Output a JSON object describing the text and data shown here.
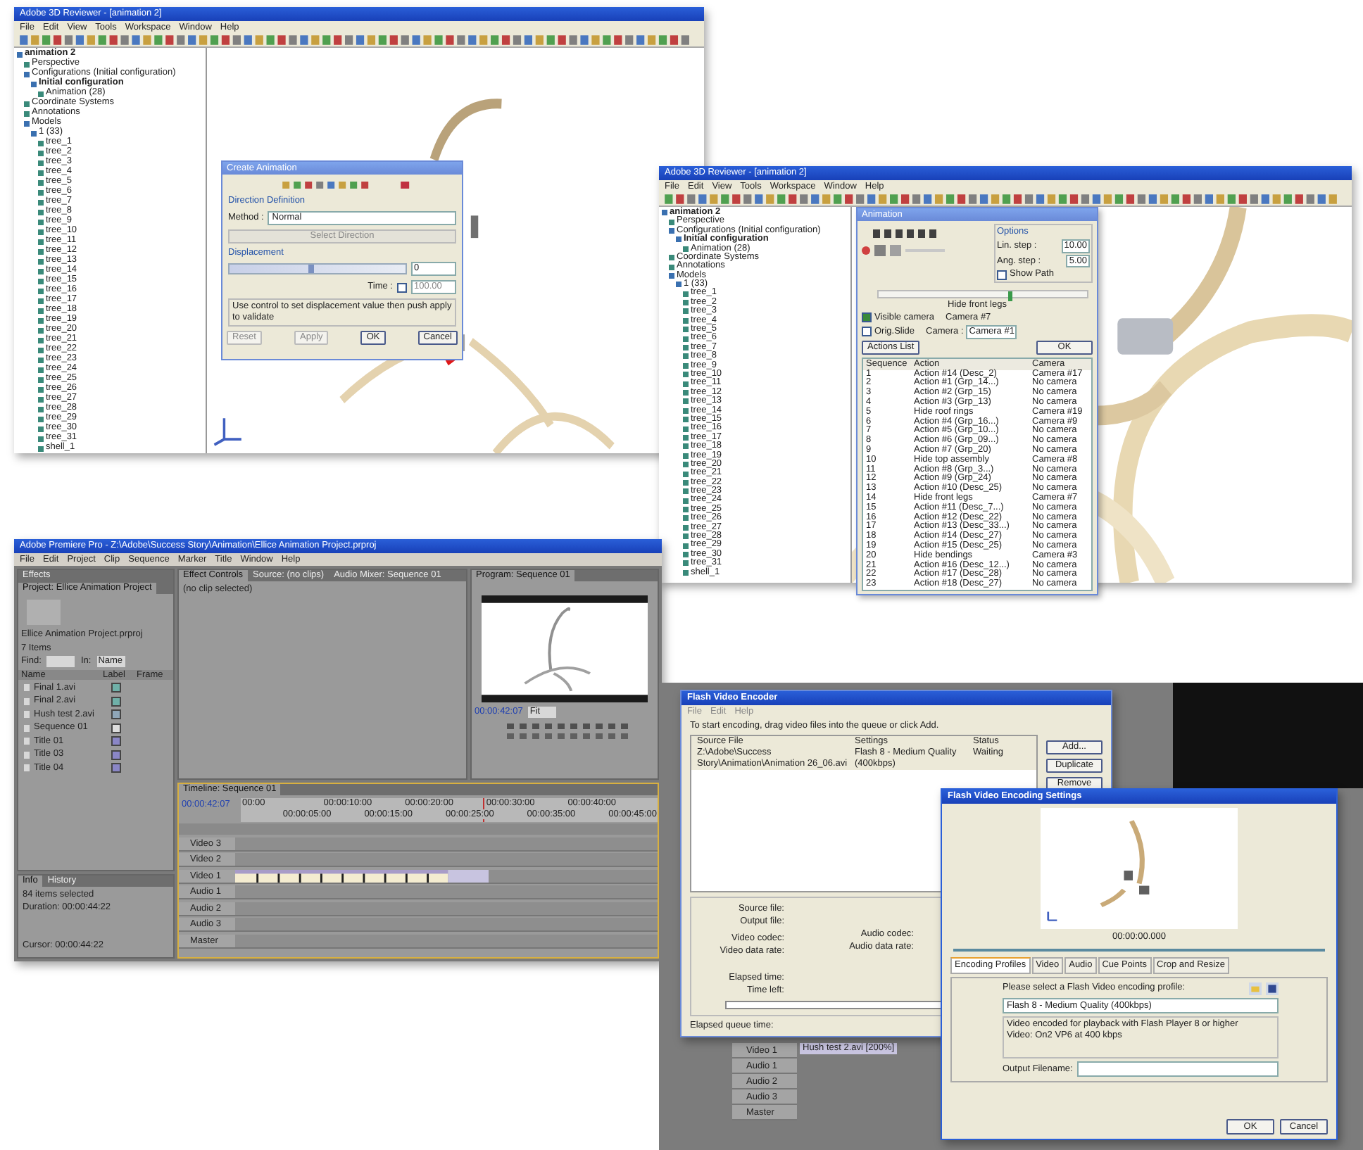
{
  "reviewer_1": {
    "title": "Adobe 3D Reviewer - [animation 2]",
    "menu": [
      "File",
      "Edit",
      "View",
      "Tools",
      "Workspace",
      "Window",
      "Help"
    ],
    "tree": [
      {
        "label": "animation 2",
        "children": [
          {
            "label": "Perspective"
          },
          {
            "label": "Configurations (Initial configuration)",
            "children": [
              {
                "label": "Initial configuration",
                "children": [
                  {
                    "label": "Animation (28)"
                  }
                ]
              }
            ]
          },
          {
            "label": "Coordinate Systems"
          },
          {
            "label": "Annotations"
          },
          {
            "label": "Models",
            "children": [
              {
                "label": "1 (33)",
                "children": [
                  {
                    "label": "tree_1"
                  },
                  {
                    "label": "tree_2"
                  },
                  {
                    "label": "tree_3"
                  },
                  {
                    "label": "tree_4"
                  },
                  {
                    "label": "tree_5"
                  },
                  {
                    "label": "tree_6"
                  },
                  {
                    "label": "tree_7"
                  },
                  {
                    "label": "tree_8"
                  },
                  {
                    "label": "tree_9"
                  },
                  {
                    "label": "tree_10"
                  },
                  {
                    "label": "tree_11"
                  },
                  {
                    "label": "tree_12"
                  },
                  {
                    "label": "tree_13"
                  },
                  {
                    "label": "tree_14"
                  },
                  {
                    "label": "tree_15"
                  },
                  {
                    "label": "tree_16"
                  },
                  {
                    "label": "tree_17"
                  },
                  {
                    "label": "tree_18"
                  },
                  {
                    "label": "tree_19"
                  },
                  {
                    "label": "tree_20"
                  },
                  {
                    "label": "tree_21"
                  },
                  {
                    "label": "tree_22"
                  },
                  {
                    "label": "tree_23"
                  },
                  {
                    "label": "tree_24"
                  },
                  {
                    "label": "tree_25"
                  },
                  {
                    "label": "tree_26"
                  },
                  {
                    "label": "tree_27"
                  },
                  {
                    "label": "tree_28"
                  },
                  {
                    "label": "tree_29"
                  },
                  {
                    "label": "tree_30"
                  },
                  {
                    "label": "tree_31"
                  },
                  {
                    "label": "shell_1"
                  }
                ]
              }
            ]
          }
        ]
      }
    ],
    "dialog": {
      "title": "Create Animation",
      "section_1": "Direction Definition",
      "method_label": "Method :",
      "method_value": "Normal",
      "select_button": "Select Direction",
      "section_2": "Displacement",
      "displacement": {
        "level": 0.45
      },
      "displacement_value": "0",
      "time_label": "Time :",
      "time_checked": false,
      "time_value": "100.00",
      "hint": "Use control to set displacement value then push apply to validate",
      "buttons": [
        {
          "label": "Reset",
          "disabled": true
        },
        {
          "label": "Apply",
          "disabled": true
        },
        {
          "label": "OK",
          "disabled": false
        },
        {
          "label": "Cancel",
          "disabled": false
        }
      ]
    }
  },
  "reviewer_2": {
    "title": "Adobe 3D Reviewer - [animation 2]",
    "menu": [
      "File",
      "Edit",
      "View",
      "Tools",
      "Workspace",
      "Window",
      "Help"
    ],
    "tree": [
      {
        "label": "animation 2",
        "children": [
          {
            "label": "Perspective"
          },
          {
            "label": "Configurations (Initial configuration)",
            "children": [
              {
                "label": "Initial configuration",
                "children": [
                  {
                    "label": "Animation (28)"
                  }
                ]
              }
            ]
          },
          {
            "label": "Coordinate Systems"
          },
          {
            "label": "Annotations"
          },
          {
            "label": "Models",
            "children": [
              {
                "label": "1 (33)",
                "children": [
                  {
                    "label": "tree_1"
                  },
                  {
                    "label": "tree_2"
                  },
                  {
                    "label": "tree_3"
                  },
                  {
                    "label": "tree_4"
                  },
                  {
                    "label": "tree_5"
                  },
                  {
                    "label": "tree_6"
                  },
                  {
                    "label": "tree_7"
                  },
                  {
                    "label": "tree_8"
                  },
                  {
                    "label": "tree_9"
                  },
                  {
                    "label": "tree_10"
                  },
                  {
                    "label": "tree_11"
                  },
                  {
                    "label": "tree_12"
                  },
                  {
                    "label": "tree_13"
                  },
                  {
                    "label": "tree_14"
                  },
                  {
                    "label": "tree_15"
                  },
                  {
                    "label": "tree_16"
                  },
                  {
                    "label": "tree_17"
                  },
                  {
                    "label": "tree_18"
                  },
                  {
                    "label": "tree_19"
                  },
                  {
                    "label": "tree_20"
                  },
                  {
                    "label": "tree_21"
                  },
                  {
                    "label": "tree_22"
                  },
                  {
                    "label": "tree_23"
                  },
                  {
                    "label": "tree_24"
                  },
                  {
                    "label": "tree_25"
                  },
                  {
                    "label": "tree_26"
                  },
                  {
                    "label": "tree_27"
                  },
                  {
                    "label": "tree_28"
                  },
                  {
                    "label": "tree_29"
                  },
                  {
                    "label": "tree_30"
                  },
                  {
                    "label": "tree_31"
                  },
                  {
                    "label": "shell_1"
                  }
                ]
              }
            ]
          }
        ]
      }
    ],
    "dialog": {
      "title": "Animation",
      "options_title": "Options",
      "lin_step_label": "Lin. step :",
      "lin_step": "10.00",
      "ang_step_label": "Ang. step :",
      "ang_step": "5.00",
      "show_path_label": "Show Path",
      "show_path_checked": false,
      "slider": {
        "level": 0.62
      },
      "current_step": "Hide front legs",
      "visible_camera_label": "Visible camera",
      "visible_camera_checked": true,
      "camera_name": "Camera #7",
      "orig_slide_label": "Orig.Slide",
      "orig_slide_checked": false,
      "camera_label": "Camera :",
      "camera_value": "Camera #1",
      "actions_button": "Actions List",
      "ok_button": "OK",
      "columns": [
        "Sequence",
        "Action",
        "Camera"
      ],
      "rows": [
        [
          "1",
          "Action #14 (Desc_2)",
          "Camera #17"
        ],
        [
          "2",
          "Action #1 (Grp_14...)",
          "No camera"
        ],
        [
          "3",
          "Action #2 (Grp_15)",
          "No camera"
        ],
        [
          "4",
          "Action #3 (Grp_13)",
          "No camera"
        ],
        [
          "5",
          "Hide roof rings",
          "Camera #19"
        ],
        [
          "6",
          "Action #4 (Grp_16...)",
          "Camera #9"
        ],
        [
          "7",
          "Action #5 (Grp_10...)",
          "No camera"
        ],
        [
          "8",
          "Action #6 (Grp_09...)",
          "No camera"
        ],
        [
          "9",
          "Action #7 (Grp_20)",
          "No camera"
        ],
        [
          "10",
          "Hide top assembly",
          "Camera #8"
        ],
        [
          "11",
          "Action #8 (Grp_3...)",
          "No camera"
        ],
        [
          "12",
          "Action #9 (Grp_24)",
          "No camera"
        ],
        [
          "13",
          "Action #10 (Desc_25)",
          "No camera"
        ],
        [
          "14",
          "Hide front legs",
          "Camera #7"
        ],
        [
          "15",
          "Action #11 (Desc_7...)",
          "No camera"
        ],
        [
          "16",
          "Action #12 (Desc_22)",
          "No camera"
        ],
        [
          "17",
          "Action #13 (Desc_33...)",
          "No camera"
        ],
        [
          "18",
          "Action #14 (Desc_27)",
          "No camera"
        ],
        [
          "19",
          "Action #15 (Desc_25)",
          "No camera"
        ],
        [
          "20",
          "Hide bendings",
          "Camera #3"
        ],
        [
          "21",
          "Action #16 (Desc_12...)",
          "No camera"
        ],
        [
          "22",
          "Action #17 (Desc_28)",
          "No camera"
        ],
        [
          "23",
          "Action #18 (Desc_27)",
          "No camera"
        ]
      ]
    }
  },
  "premiere": {
    "title": "Adobe Premiere Pro - Z:\\Adobe\\Success Story\\Animation\\Ellice Animation Project.prproj",
    "menu": [
      "File",
      "Edit",
      "Project",
      "Clip",
      "Sequence",
      "Marker",
      "Title",
      "Window",
      "Help"
    ],
    "project_tabs": [
      {
        "label": "Effects",
        "selected": false
      },
      {
        "label": "Project: Ellice Animation Project",
        "selected": true
      }
    ],
    "project_name": "Ellice Animation Project.prproj",
    "item_count": "7 Items",
    "find_label": "Find:",
    "in_label": "In:",
    "in_value": "Name",
    "columns": [
      "Name",
      "Label",
      "Frame"
    ],
    "items": [
      {
        "name": "Final 1.avi",
        "color": "#6fb0a8"
      },
      {
        "name": "Final 2.avi",
        "color": "#6fb0a8"
      },
      {
        "name": "Hush test 2.avi",
        "color": "#8fa6b8"
      },
      {
        "name": "Sequence 01",
        "color": "#dcdcdc"
      },
      {
        "name": "Title 01",
        "color": "#8a86c6"
      },
      {
        "name": "Title 03",
        "color": "#8a86c6"
      },
      {
        "name": "Title 04",
        "color": "#8a86c6"
      }
    ],
    "info_tabs": [
      {
        "label": "Info",
        "selected": true
      },
      {
        "label": "History",
        "selected": false
      }
    ],
    "info_lines": [
      "84 items selected",
      "Duration: 00:00:44:22"
    ],
    "cursor": "Cursor: 00:00:44:22",
    "source_tabs": [
      {
        "label": "Effect Controls",
        "selected": true
      },
      {
        "label": "Source: (no clips)",
        "selected": false
      },
      {
        "label": "Audio Mixer: Sequence 01",
        "selected": false
      }
    ],
    "no_clip": "(no clip selected)",
    "program_tab": "Program: Sequence 01",
    "program_time": "00:00:42:07",
    "zoom": "Fit",
    "timeline_tab": "Timeline: Sequence 01",
    "timeline_time": "00:00:42:07",
    "ruler": [
      "00:00",
      "00:00:05:00",
      "00:00:10:00",
      "00:00:15:00",
      "00:00:20:00",
      "00:00:25:00",
      "00:00:30:00",
      "00:00:35:00",
      "00:00:40:00",
      "00:00:45:00"
    ],
    "playhead": {
      "level": 0.58
    },
    "tracks": [
      {
        "name": "Video 3",
        "kind": "empty"
      },
      {
        "name": "Video 2",
        "kind": "empty"
      },
      {
        "name": "Video 1",
        "kind": "clips"
      },
      {
        "name": "Audio 1",
        "kind": "empty"
      },
      {
        "name": "Audio 2",
        "kind": "empty"
      },
      {
        "name": "Audio 3",
        "kind": "empty"
      },
      {
        "name": "Master",
        "kind": "empty"
      }
    ]
  },
  "background_timeline": {
    "clip": "Hush test 2.avi [200%]",
    "tracks": [
      "Video 1",
      "Audio 1",
      "Audio 2",
      "Audio 3",
      "Master"
    ]
  },
  "encoder": {
    "title": "Flash Video Encoder",
    "menu": [
      "File",
      "Edit",
      "Help"
    ],
    "instruction": "To start encoding, drag video files into the queue or click Add.",
    "columns": [
      "Source File",
      "Settings",
      "Status"
    ],
    "rows": [
      [
        "Z:\\Adobe\\Success Story\\Animation\\Animation 26_06.avi",
        "Flash 8 - Medium Quality (400kbps)",
        "Waiting"
      ]
    ],
    "buttons": [
      "Add...",
      "Duplicate",
      "Remove"
    ],
    "left_labels": [
      "Source file:",
      "Output file:",
      "Video codec:",
      "Video data rate:"
    ],
    "right_labels": [
      "Audio codec:",
      "Audio data rate:"
    ],
    "time_labels": [
      "Elapsed time:",
      "Time left:"
    ],
    "progress": {
      "level": 0
    },
    "queue_time": "Elapsed queue time:"
  },
  "settings": {
    "title": "Flash Video Encoding Settings",
    "time": "00:00:00.000",
    "tabs": [
      {
        "label": "Encoding Profiles",
        "selected": true
      },
      {
        "label": "Video",
        "selected": false
      },
      {
        "label": "Audio",
        "selected": false
      },
      {
        "label": "Cue Points",
        "selected": false
      },
      {
        "label": "Crop and Resize",
        "selected": false
      }
    ],
    "prompt": "Please select a Flash Video encoding profile:",
    "profile": "Flash 8 - Medium Quality (400kbps)",
    "description": [
      "Video encoded for playback with Flash Player 8 or higher",
      "Video: On2 VP6 at 400 kbps"
    ],
    "output_label": "Output Filename:",
    "buttons": [
      "OK",
      "Cancel"
    ]
  }
}
